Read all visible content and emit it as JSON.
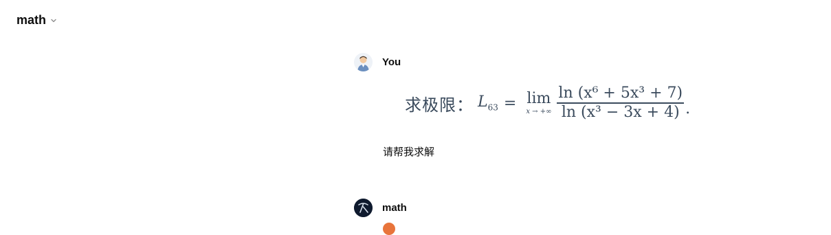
{
  "header": {
    "title": "math"
  },
  "messages": [
    {
      "sender": "You",
      "text": "请帮我求解",
      "formula": {
        "prefix": "求极限：",
        "lhs_var": "L",
        "lhs_sub": "63",
        "equals": "=",
        "lim": "lim",
        "lim_sub": "x → +∞",
        "numerator": "ln (x⁶ + 5x³ + 7)",
        "denominator": "ln (x³ − 3x + 4)",
        "period": "."
      }
    },
    {
      "sender": "math"
    }
  ],
  "colors": {
    "formula": "#3a4a5c",
    "accent_orange": "#e8743b",
    "bot_avatar": "#0f1a2e"
  },
  "icons": {
    "title_chevron": "chevron-down-icon",
    "user_avatar": "user-avatar-icon",
    "bot_avatar": "bot-avatar-icon"
  }
}
